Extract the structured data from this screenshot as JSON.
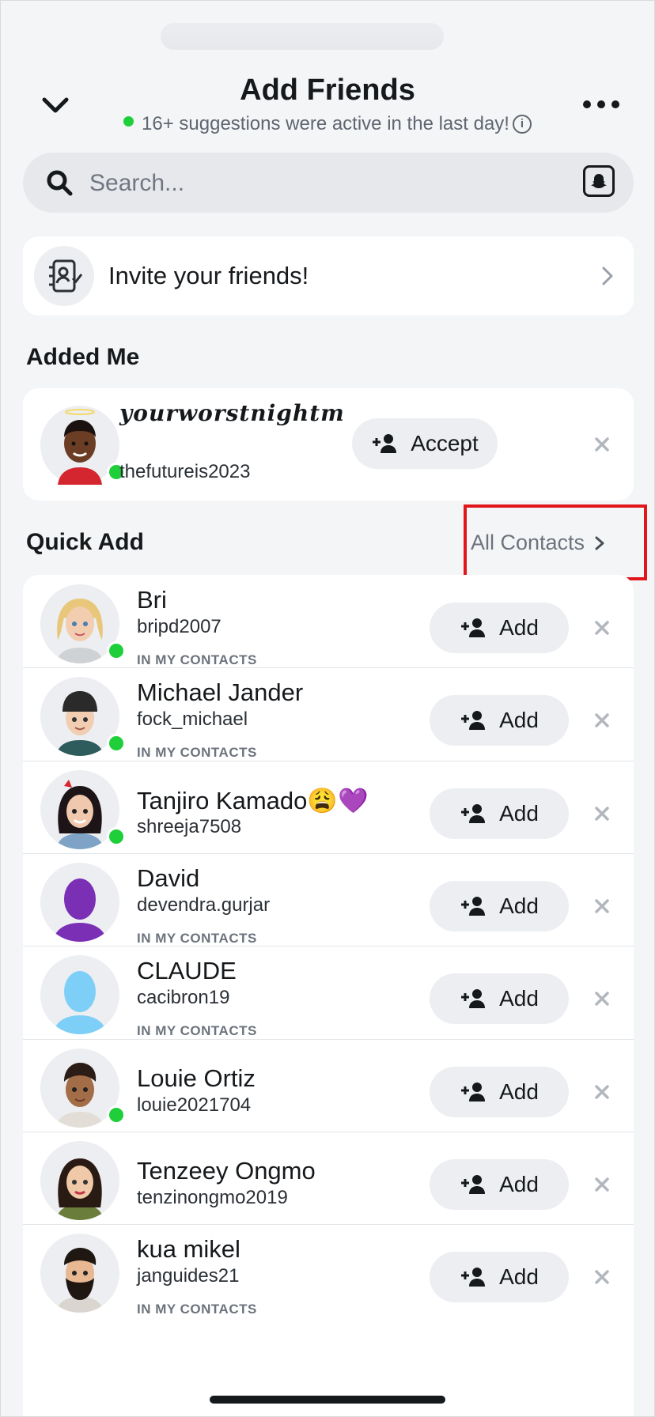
{
  "header": {
    "title": "Add Friends",
    "subtitle": "16+ suggestions were active in the last day!"
  },
  "search": {
    "placeholder": "Search..."
  },
  "invite": {
    "label": "Invite your friends!"
  },
  "added_me": {
    "heading": "Added Me",
    "entry": {
      "display_name": "𝒚𝒐𝒖𝒓𝒘𝒐𝒓𝒔𝒕𝒏𝒊𝒈𝒉𝒕𝒎",
      "username": "thefutureis2023",
      "action_label": "Accept",
      "online": true
    }
  },
  "quick_add": {
    "heading": "Quick Add",
    "all_contacts_label": "All Contacts",
    "action_label": "Add",
    "contact_tag": "IN MY CONTACTS",
    "items": [
      {
        "name": "Bri",
        "username": "bripd2007",
        "tag": "IN MY CONTACTS",
        "online": true
      },
      {
        "name": "Michael Jander",
        "username": "fock_michael",
        "tag": "IN MY CONTACTS",
        "online": true
      },
      {
        "name": "Tanjiro Kamado😩💜",
        "username": "shreeja7508",
        "tag": "",
        "online": true
      },
      {
        "name": "David",
        "username": "devendra.gurjar",
        "tag": "IN MY CONTACTS",
        "online": false
      },
      {
        "name": "CLAUDE",
        "username": "cacibron19",
        "tag": "IN MY CONTACTS",
        "online": false
      },
      {
        "name": "Louie Ortiz",
        "username": "louie2021704",
        "tag": "",
        "online": true
      },
      {
        "name": "Tenzeey Ongmo",
        "username": "tenzinongmo2019",
        "tag": "",
        "online": false
      },
      {
        "name": "kua mikel",
        "username": "janguides21",
        "tag": "IN MY CONTACTS",
        "online": false
      }
    ]
  },
  "colors": {
    "online": "#1ecf3a",
    "highlight": "#e0161b",
    "background": "#f4f5f7"
  }
}
